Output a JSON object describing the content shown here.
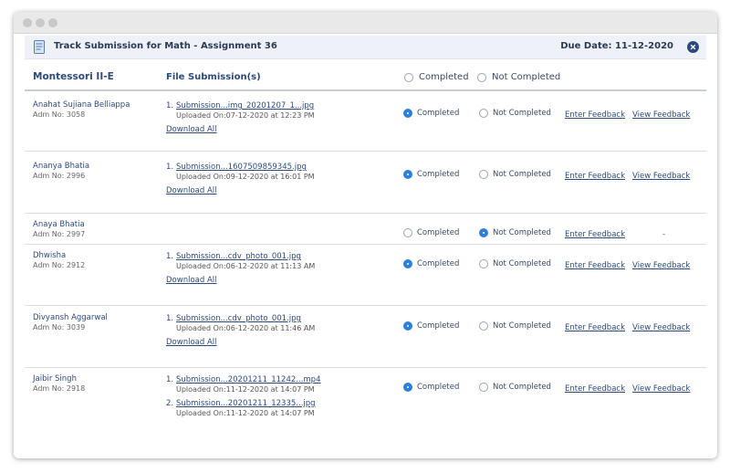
{
  "header": {
    "title": "Track Submission for Math - Assignment 36",
    "due_date": "Due Date: 11-12-2020"
  },
  "columns": {
    "class_name": "Montessori II-E",
    "file_submissions": "File Submission(s)",
    "completed": "Completed",
    "not_completed": "Not Completed"
  },
  "labels": {
    "completed": "Completed",
    "not_completed": "Not Completed",
    "enter_feedback": "Enter Feedback",
    "view_feedback": "View Feedback",
    "download_all": "Download All",
    "no_feedback": "-"
  },
  "students": [
    {
      "name": "Anahat Sujiana Belliappa",
      "adm": "Adm No: 3058",
      "status": "completed",
      "files": [
        {
          "num": "1.",
          "name": "Submission...img_20201207_1...jpg",
          "uploaded": "Uploaded On:07-12-2020 at 12:23 PM"
        }
      ]
    },
    {
      "name": "Ananya Bhatia",
      "adm": "Adm No: 2996",
      "status": "completed",
      "files": [
        {
          "num": "1.",
          "name": "Submission...1607509859345.jpg",
          "uploaded": "Uploaded On:09-12-2020 at 16:01 PM"
        }
      ]
    },
    {
      "name": "Anaya Bhatia",
      "adm": "Adm No: 2997",
      "status": "not_completed",
      "files": []
    },
    {
      "name": "Dhwisha",
      "adm": "Adm No: 2912",
      "status": "completed",
      "files": [
        {
          "num": "1.",
          "name": "Submission...cdv_photo_001.jpg",
          "uploaded": "Uploaded On:06-12-2020 at 11:13 AM"
        }
      ]
    },
    {
      "name": "Divyansh Aggarwal",
      "adm": "Adm No: 3039",
      "status": "completed",
      "files": [
        {
          "num": "1.",
          "name": "Submission...cdv_photo_001.jpg",
          "uploaded": "Uploaded On:06-12-2020 at 11:46 AM"
        }
      ]
    },
    {
      "name": "Jaibir Singh",
      "adm": "Adm No: 2918",
      "status": "completed",
      "files": [
        {
          "num": "1.",
          "name": "Submission...20201211_11242...mp4",
          "uploaded": "Uploaded On:11-12-2020 at 14:07 PM"
        },
        {
          "num": "2.",
          "name": "Submission...20201211_12335...jpg",
          "uploaded": "Uploaded On:11-12-2020 at 14:07 PM"
        }
      ]
    }
  ],
  "colors": {
    "accent": "#2f7ed8",
    "link": "#2c4a7c",
    "header_bg": "#eef2f8"
  }
}
